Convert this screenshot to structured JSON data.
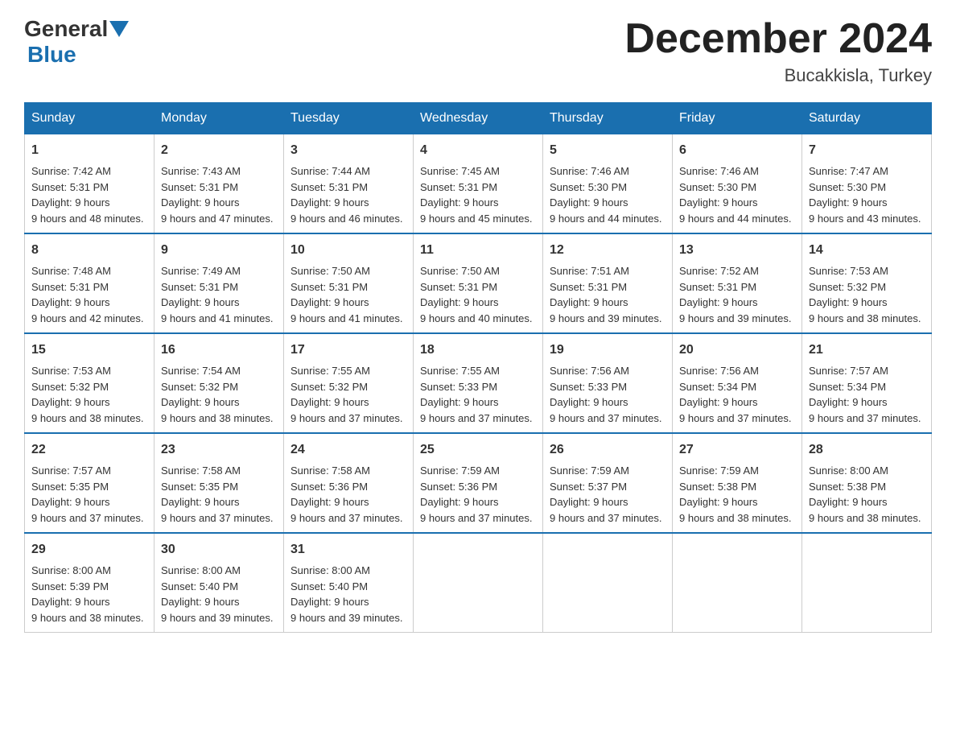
{
  "logo": {
    "general": "General",
    "blue": "Blue"
  },
  "header": {
    "month": "December 2024",
    "location": "Bucakkisla, Turkey"
  },
  "days_of_week": [
    "Sunday",
    "Monday",
    "Tuesday",
    "Wednesday",
    "Thursday",
    "Friday",
    "Saturday"
  ],
  "weeks": [
    [
      {
        "day": "1",
        "sunrise": "7:42 AM",
        "sunset": "5:31 PM",
        "daylight": "9 hours and 48 minutes."
      },
      {
        "day": "2",
        "sunrise": "7:43 AM",
        "sunset": "5:31 PM",
        "daylight": "9 hours and 47 minutes."
      },
      {
        "day": "3",
        "sunrise": "7:44 AM",
        "sunset": "5:31 PM",
        "daylight": "9 hours and 46 minutes."
      },
      {
        "day": "4",
        "sunrise": "7:45 AM",
        "sunset": "5:31 PM",
        "daylight": "9 hours and 45 minutes."
      },
      {
        "day": "5",
        "sunrise": "7:46 AM",
        "sunset": "5:30 PM",
        "daylight": "9 hours and 44 minutes."
      },
      {
        "day": "6",
        "sunrise": "7:46 AM",
        "sunset": "5:30 PM",
        "daylight": "9 hours and 44 minutes."
      },
      {
        "day": "7",
        "sunrise": "7:47 AM",
        "sunset": "5:30 PM",
        "daylight": "9 hours and 43 minutes."
      }
    ],
    [
      {
        "day": "8",
        "sunrise": "7:48 AM",
        "sunset": "5:31 PM",
        "daylight": "9 hours and 42 minutes."
      },
      {
        "day": "9",
        "sunrise": "7:49 AM",
        "sunset": "5:31 PM",
        "daylight": "9 hours and 41 minutes."
      },
      {
        "day": "10",
        "sunrise": "7:50 AM",
        "sunset": "5:31 PM",
        "daylight": "9 hours and 41 minutes."
      },
      {
        "day": "11",
        "sunrise": "7:50 AM",
        "sunset": "5:31 PM",
        "daylight": "9 hours and 40 minutes."
      },
      {
        "day": "12",
        "sunrise": "7:51 AM",
        "sunset": "5:31 PM",
        "daylight": "9 hours and 39 minutes."
      },
      {
        "day": "13",
        "sunrise": "7:52 AM",
        "sunset": "5:31 PM",
        "daylight": "9 hours and 39 minutes."
      },
      {
        "day": "14",
        "sunrise": "7:53 AM",
        "sunset": "5:32 PM",
        "daylight": "9 hours and 38 minutes."
      }
    ],
    [
      {
        "day": "15",
        "sunrise": "7:53 AM",
        "sunset": "5:32 PM",
        "daylight": "9 hours and 38 minutes."
      },
      {
        "day": "16",
        "sunrise": "7:54 AM",
        "sunset": "5:32 PM",
        "daylight": "9 hours and 38 minutes."
      },
      {
        "day": "17",
        "sunrise": "7:55 AM",
        "sunset": "5:32 PM",
        "daylight": "9 hours and 37 minutes."
      },
      {
        "day": "18",
        "sunrise": "7:55 AM",
        "sunset": "5:33 PM",
        "daylight": "9 hours and 37 minutes."
      },
      {
        "day": "19",
        "sunrise": "7:56 AM",
        "sunset": "5:33 PM",
        "daylight": "9 hours and 37 minutes."
      },
      {
        "day": "20",
        "sunrise": "7:56 AM",
        "sunset": "5:34 PM",
        "daylight": "9 hours and 37 minutes."
      },
      {
        "day": "21",
        "sunrise": "7:57 AM",
        "sunset": "5:34 PM",
        "daylight": "9 hours and 37 minutes."
      }
    ],
    [
      {
        "day": "22",
        "sunrise": "7:57 AM",
        "sunset": "5:35 PM",
        "daylight": "9 hours and 37 minutes."
      },
      {
        "day": "23",
        "sunrise": "7:58 AM",
        "sunset": "5:35 PM",
        "daylight": "9 hours and 37 minutes."
      },
      {
        "day": "24",
        "sunrise": "7:58 AM",
        "sunset": "5:36 PM",
        "daylight": "9 hours and 37 minutes."
      },
      {
        "day": "25",
        "sunrise": "7:59 AM",
        "sunset": "5:36 PM",
        "daylight": "9 hours and 37 minutes."
      },
      {
        "day": "26",
        "sunrise": "7:59 AM",
        "sunset": "5:37 PM",
        "daylight": "9 hours and 37 minutes."
      },
      {
        "day": "27",
        "sunrise": "7:59 AM",
        "sunset": "5:38 PM",
        "daylight": "9 hours and 38 minutes."
      },
      {
        "day": "28",
        "sunrise": "8:00 AM",
        "sunset": "5:38 PM",
        "daylight": "9 hours and 38 minutes."
      }
    ],
    [
      {
        "day": "29",
        "sunrise": "8:00 AM",
        "sunset": "5:39 PM",
        "daylight": "9 hours and 38 minutes."
      },
      {
        "day": "30",
        "sunrise": "8:00 AM",
        "sunset": "5:40 PM",
        "daylight": "9 hours and 39 minutes."
      },
      {
        "day": "31",
        "sunrise": "8:00 AM",
        "sunset": "5:40 PM",
        "daylight": "9 hours and 39 minutes."
      },
      null,
      null,
      null,
      null
    ]
  ]
}
